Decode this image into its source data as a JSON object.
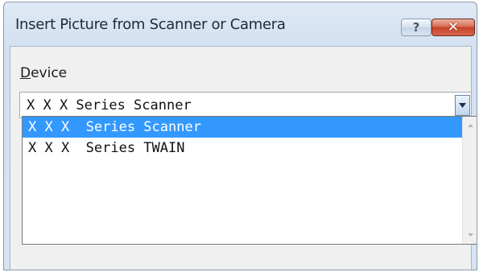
{
  "window": {
    "title": "Insert Picture from Scanner or Camera",
    "help_label": "?",
    "close_label": "✕"
  },
  "device": {
    "label_prefix": "D",
    "label_rest": "evice",
    "selected_value": "X X X  Series Scanner"
  },
  "dropdown": {
    "items": [
      {
        "label": "X X X  Series Scanner",
        "selected": true
      },
      {
        "label": "X X X  Series TWAIN",
        "selected": false
      }
    ]
  },
  "icons": {
    "dropdown_arrow": "chevron-down-icon",
    "scroll_up": "scroll-up-arrow-icon",
    "scroll_down": "scroll-down-arrow-icon"
  },
  "colors": {
    "selection": "#3399ff",
    "close_button": "#c7432a",
    "title_bar": "#d2e0f0"
  }
}
